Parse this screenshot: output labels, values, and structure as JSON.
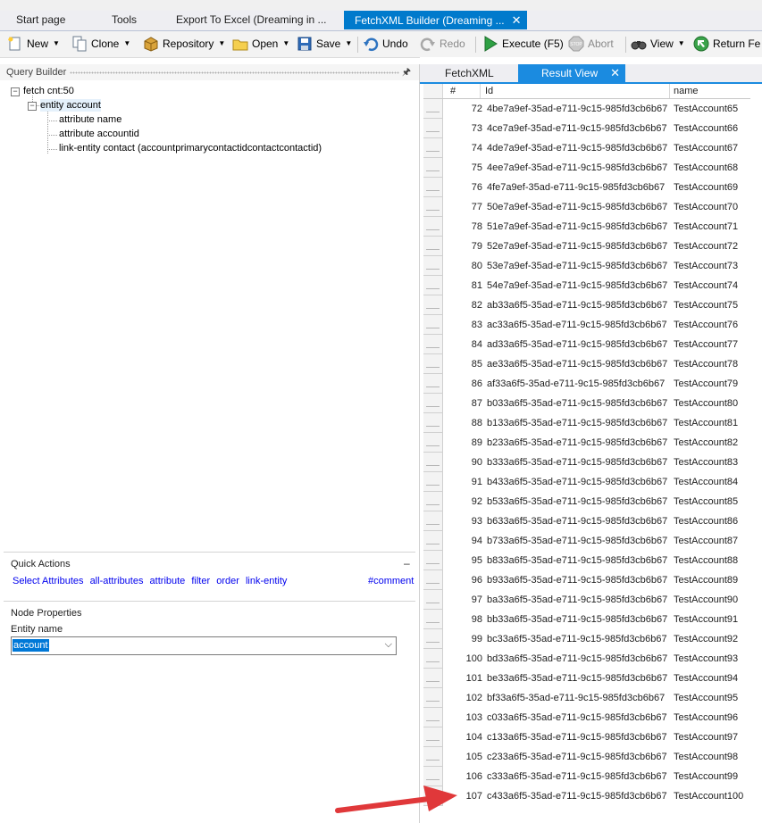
{
  "doc_tabs": [
    {
      "label": "Start page"
    },
    {
      "label": "Tools"
    },
    {
      "label": "Export To Excel (Dreaming in ..."
    },
    {
      "label": "FetchXML Builder (Dreaming ...",
      "close": "✕"
    }
  ],
  "toolbar": {
    "new": "New",
    "clone": "Clone",
    "repository": "Repository",
    "open": "Open",
    "save": "Save",
    "undo": "Undo",
    "redo": "Redo",
    "execute": "Execute (F5)",
    "abort": "Abort",
    "view": "View",
    "return": "Return Fe"
  },
  "query_builder": {
    "title": "Query Builder",
    "pin": "🖈",
    "tree": {
      "fetch": "fetch cnt:50",
      "entity": "entity account",
      "attr_name": "attribute name",
      "attr_id": "attribute accountid",
      "link_entity": "link-entity contact (accountprimarycontactidcontactcontactid)"
    }
  },
  "quick_actions": {
    "title": "Quick Actions",
    "collapse": "–",
    "links": [
      "Select Attributes",
      "all-attributes",
      "attribute",
      "filter",
      "order",
      "link-entity"
    ],
    "comment": "#comment"
  },
  "node_properties": {
    "title": "Node Properties",
    "entity_label": "Entity name",
    "entity_value": "account",
    "chevron": "⌵"
  },
  "result_tabs": {
    "fetchxml": "FetchXML",
    "result": "Result View",
    "close": "✕"
  },
  "grid": {
    "headers": {
      "num": "#",
      "id": "Id",
      "name": "name"
    },
    "rows": [
      {
        "num": "72",
        "id": "4be7a9ef-35ad-e711-9c15-985fd3cb6b67",
        "name": "TestAccount65"
      },
      {
        "num": "73",
        "id": "4ce7a9ef-35ad-e711-9c15-985fd3cb6b67",
        "name": "TestAccount66"
      },
      {
        "num": "74",
        "id": "4de7a9ef-35ad-e711-9c15-985fd3cb6b67",
        "name": "TestAccount67"
      },
      {
        "num": "75",
        "id": "4ee7a9ef-35ad-e711-9c15-985fd3cb6b67",
        "name": "TestAccount68"
      },
      {
        "num": "76",
        "id": "4fe7a9ef-35ad-e711-9c15-985fd3cb6b67",
        "name": "TestAccount69"
      },
      {
        "num": "77",
        "id": "50e7a9ef-35ad-e711-9c15-985fd3cb6b67",
        "name": "TestAccount70"
      },
      {
        "num": "78",
        "id": "51e7a9ef-35ad-e711-9c15-985fd3cb6b67",
        "name": "TestAccount71"
      },
      {
        "num": "79",
        "id": "52e7a9ef-35ad-e711-9c15-985fd3cb6b67",
        "name": "TestAccount72"
      },
      {
        "num": "80",
        "id": "53e7a9ef-35ad-e711-9c15-985fd3cb6b67",
        "name": "TestAccount73"
      },
      {
        "num": "81",
        "id": "54e7a9ef-35ad-e711-9c15-985fd3cb6b67",
        "name": "TestAccount74"
      },
      {
        "num": "82",
        "id": "ab33a6f5-35ad-e711-9c15-985fd3cb6b67",
        "name": "TestAccount75"
      },
      {
        "num": "83",
        "id": "ac33a6f5-35ad-e711-9c15-985fd3cb6b67",
        "name": "TestAccount76"
      },
      {
        "num": "84",
        "id": "ad33a6f5-35ad-e711-9c15-985fd3cb6b67",
        "name": "TestAccount77"
      },
      {
        "num": "85",
        "id": "ae33a6f5-35ad-e711-9c15-985fd3cb6b67",
        "name": "TestAccount78"
      },
      {
        "num": "86",
        "id": "af33a6f5-35ad-e711-9c15-985fd3cb6b67",
        "name": "TestAccount79"
      },
      {
        "num": "87",
        "id": "b033a6f5-35ad-e711-9c15-985fd3cb6b67",
        "name": "TestAccount80"
      },
      {
        "num": "88",
        "id": "b133a6f5-35ad-e711-9c15-985fd3cb6b67",
        "name": "TestAccount81"
      },
      {
        "num": "89",
        "id": "b233a6f5-35ad-e711-9c15-985fd3cb6b67",
        "name": "TestAccount82"
      },
      {
        "num": "90",
        "id": "b333a6f5-35ad-e711-9c15-985fd3cb6b67",
        "name": "TestAccount83"
      },
      {
        "num": "91",
        "id": "b433a6f5-35ad-e711-9c15-985fd3cb6b67",
        "name": "TestAccount84"
      },
      {
        "num": "92",
        "id": "b533a6f5-35ad-e711-9c15-985fd3cb6b67",
        "name": "TestAccount85"
      },
      {
        "num": "93",
        "id": "b633a6f5-35ad-e711-9c15-985fd3cb6b67",
        "name": "TestAccount86"
      },
      {
        "num": "94",
        "id": "b733a6f5-35ad-e711-9c15-985fd3cb6b67",
        "name": "TestAccount87"
      },
      {
        "num": "95",
        "id": "b833a6f5-35ad-e711-9c15-985fd3cb6b67",
        "name": "TestAccount88"
      },
      {
        "num": "96",
        "id": "b933a6f5-35ad-e711-9c15-985fd3cb6b67",
        "name": "TestAccount89"
      },
      {
        "num": "97",
        "id": "ba33a6f5-35ad-e711-9c15-985fd3cb6b67",
        "name": "TestAccount90"
      },
      {
        "num": "98",
        "id": "bb33a6f5-35ad-e711-9c15-985fd3cb6b67",
        "name": "TestAccount91"
      },
      {
        "num": "99",
        "id": "bc33a6f5-35ad-e711-9c15-985fd3cb6b67",
        "name": "TestAccount92"
      },
      {
        "num": "100",
        "id": "bd33a6f5-35ad-e711-9c15-985fd3cb6b67",
        "name": "TestAccount93"
      },
      {
        "num": "101",
        "id": "be33a6f5-35ad-e711-9c15-985fd3cb6b67",
        "name": "TestAccount94"
      },
      {
        "num": "102",
        "id": "bf33a6f5-35ad-e711-9c15-985fd3cb6b67",
        "name": "TestAccount95"
      },
      {
        "num": "103",
        "id": "c033a6f5-35ad-e711-9c15-985fd3cb6b67",
        "name": "TestAccount96"
      },
      {
        "num": "104",
        "id": "c133a6f5-35ad-e711-9c15-985fd3cb6b67",
        "name": "TestAccount97"
      },
      {
        "num": "105",
        "id": "c233a6f5-35ad-e711-9c15-985fd3cb6b67",
        "name": "TestAccount98"
      },
      {
        "num": "106",
        "id": "c333a6f5-35ad-e711-9c15-985fd3cb6b67",
        "name": "TestAccount99"
      },
      {
        "num": "107",
        "id": "c433a6f5-35ad-e711-9c15-985fd3cb6b67",
        "name": "TestAccount100"
      }
    ]
  },
  "colors": {
    "accent_tab": "#007acc",
    "result_tab": "#1b8be0",
    "annotation_arrow": "#e0383a",
    "link": "#0000ee"
  }
}
